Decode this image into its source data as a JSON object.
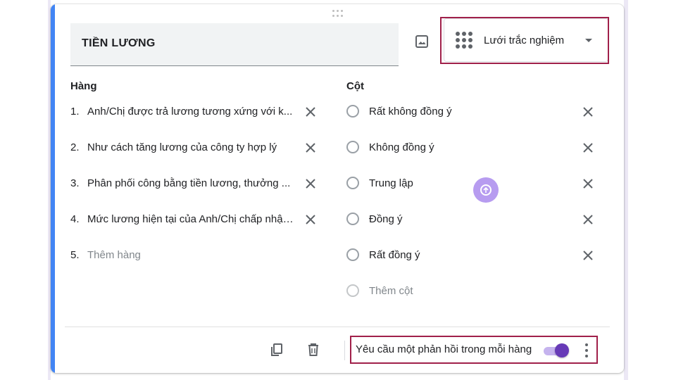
{
  "question": {
    "title": "TIỀN LƯƠNG",
    "type_label": "Lưới trắc nghiệm"
  },
  "rows": {
    "heading": "Hàng",
    "items": [
      {
        "num": "1.",
        "text": "Anh/Chị được trả lương tương xứng với k..."
      },
      {
        "num": "2.",
        "text": "Như cách tăng lương của công ty hợp lý"
      },
      {
        "num": "3.",
        "text": "Phân phối công bằng tiền lương, thưởng ..."
      },
      {
        "num": "4.",
        "text": "Mức lương hiện tại của Anh/Chị chấp nhận..."
      }
    ],
    "add": {
      "num": "5.",
      "text": "Thêm hàng"
    }
  },
  "columns": {
    "heading": "Cột",
    "items": [
      {
        "text": "Rất không đồng ý"
      },
      {
        "text": "Không đồng ý"
      },
      {
        "text": "Trung lập"
      },
      {
        "text": "Đồng ý"
      },
      {
        "text": "Rất đồng ý"
      }
    ],
    "add": {
      "text": "Thêm cột"
    }
  },
  "footer": {
    "required_label": "Yêu cầu một phản hồi trong mỗi hàng",
    "required_on": true
  },
  "icons": {
    "image": "image-icon",
    "type": "grid-icon",
    "remove": "close-icon",
    "duplicate": "copy-icon",
    "delete": "trash-icon",
    "more": "more-vert-icon"
  },
  "colors": {
    "accent": "#4285f4",
    "toggle": "#673ab7",
    "highlight": "#a0204a"
  }
}
